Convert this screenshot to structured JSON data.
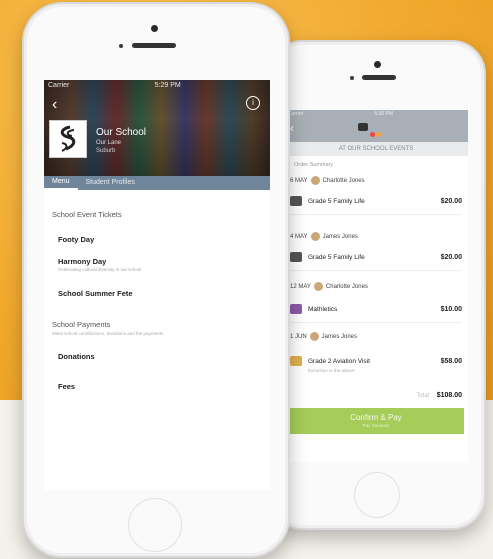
{
  "front": {
    "status": {
      "carrier": "Carrier",
      "time": "5:29 PM",
      "battery": ""
    },
    "school_name": "Our School",
    "school_line1": "Our Lane",
    "school_line2": "Suburb",
    "tabs": [
      {
        "label": "Menu",
        "active": true
      },
      {
        "label": "Student Profiles",
        "active": false
      }
    ],
    "sections": [
      {
        "title": "School Event Tickets",
        "items": [
          {
            "label": "Footy Day",
            "subtitle": ""
          },
          {
            "label": "Harmony Day",
            "subtitle": "Celebrating cultural diversity in our school"
          },
          {
            "label": "School Summer Fete",
            "subtitle": ""
          }
        ]
      },
      {
        "title": "School Payments",
        "subtitle": "Make school contributions, donations and fee payments",
        "items": [
          {
            "label": "Donations",
            "subtitle": ""
          },
          {
            "label": "Fees",
            "subtitle": ""
          }
        ]
      }
    ],
    "home_label": ""
  },
  "back": {
    "status": {
      "carrier": "Carrier",
      "time": "5:30 PM",
      "battery": ""
    },
    "subheader": "AT OUR SCHOOL EVENTS",
    "cart_heading": "Order Summary",
    "groups": [
      {
        "date": "6 MAY",
        "person": "Charlotte Jones",
        "item": "Grade 5 Family Life",
        "price": "$20.00",
        "sub": ""
      },
      {
        "date": "4 MAY",
        "person": "James Jones",
        "item": "Grade 5 Family Life",
        "price": "$20.00",
        "sub": ""
      },
      {
        "date": "12 MAY",
        "person": "Charlotte Jones",
        "item": "Mathletics",
        "price": "$10.00",
        "sub": ""
      },
      {
        "date": "1 JUN",
        "person": "James Jones",
        "item": "Grade 2 Aviation Visit",
        "price": "$58.00",
        "sub": "Excursion to the airport"
      }
    ],
    "total_label": "Total",
    "total_value": "$108.00",
    "confirm_label": "Confirm & Pay",
    "confirm_sub": "Pay Securely"
  }
}
